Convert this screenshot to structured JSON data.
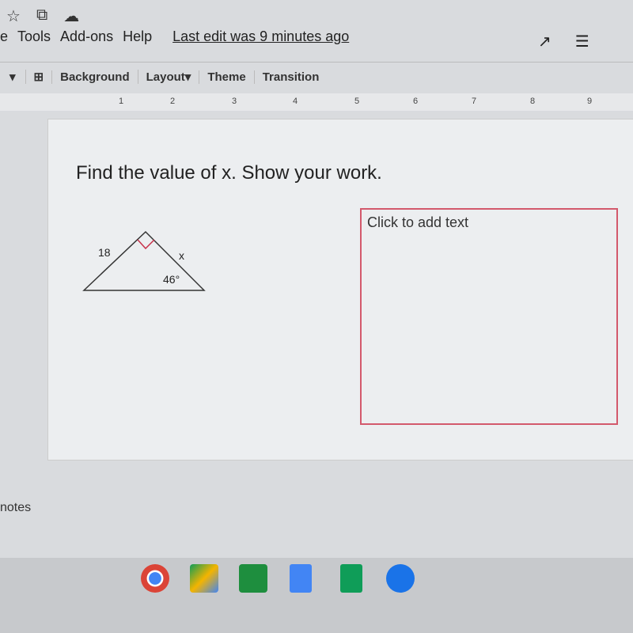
{
  "top_icons": [
    "star-icon",
    "move-to-folder-icon",
    "cloud-saved-icon"
  ],
  "menu": {
    "items": [
      "e",
      "Tools",
      "Add-ons",
      "Help"
    ],
    "last_edit": "Last edit was 9 minutes ago"
  },
  "right_icons": [
    "activity-icon",
    "comments-icon"
  ],
  "toolbar": {
    "background": "Background",
    "layout": "Layout",
    "theme": "Theme",
    "transition": "Transition"
  },
  "ruler": [
    "1",
    "2",
    "3",
    "4",
    "5",
    "6",
    "7",
    "8",
    "9"
  ],
  "slide": {
    "question": "Find the value of x. Show your work.",
    "triangle": {
      "side_left": "18",
      "side_right": "x",
      "angle": "46°"
    },
    "textbox_placeholder": "Click to add text"
  },
  "notes_label": "notes",
  "shelf_apps": [
    "chrome",
    "google-drive",
    "classroom",
    "docs",
    "sheets",
    "files"
  ]
}
